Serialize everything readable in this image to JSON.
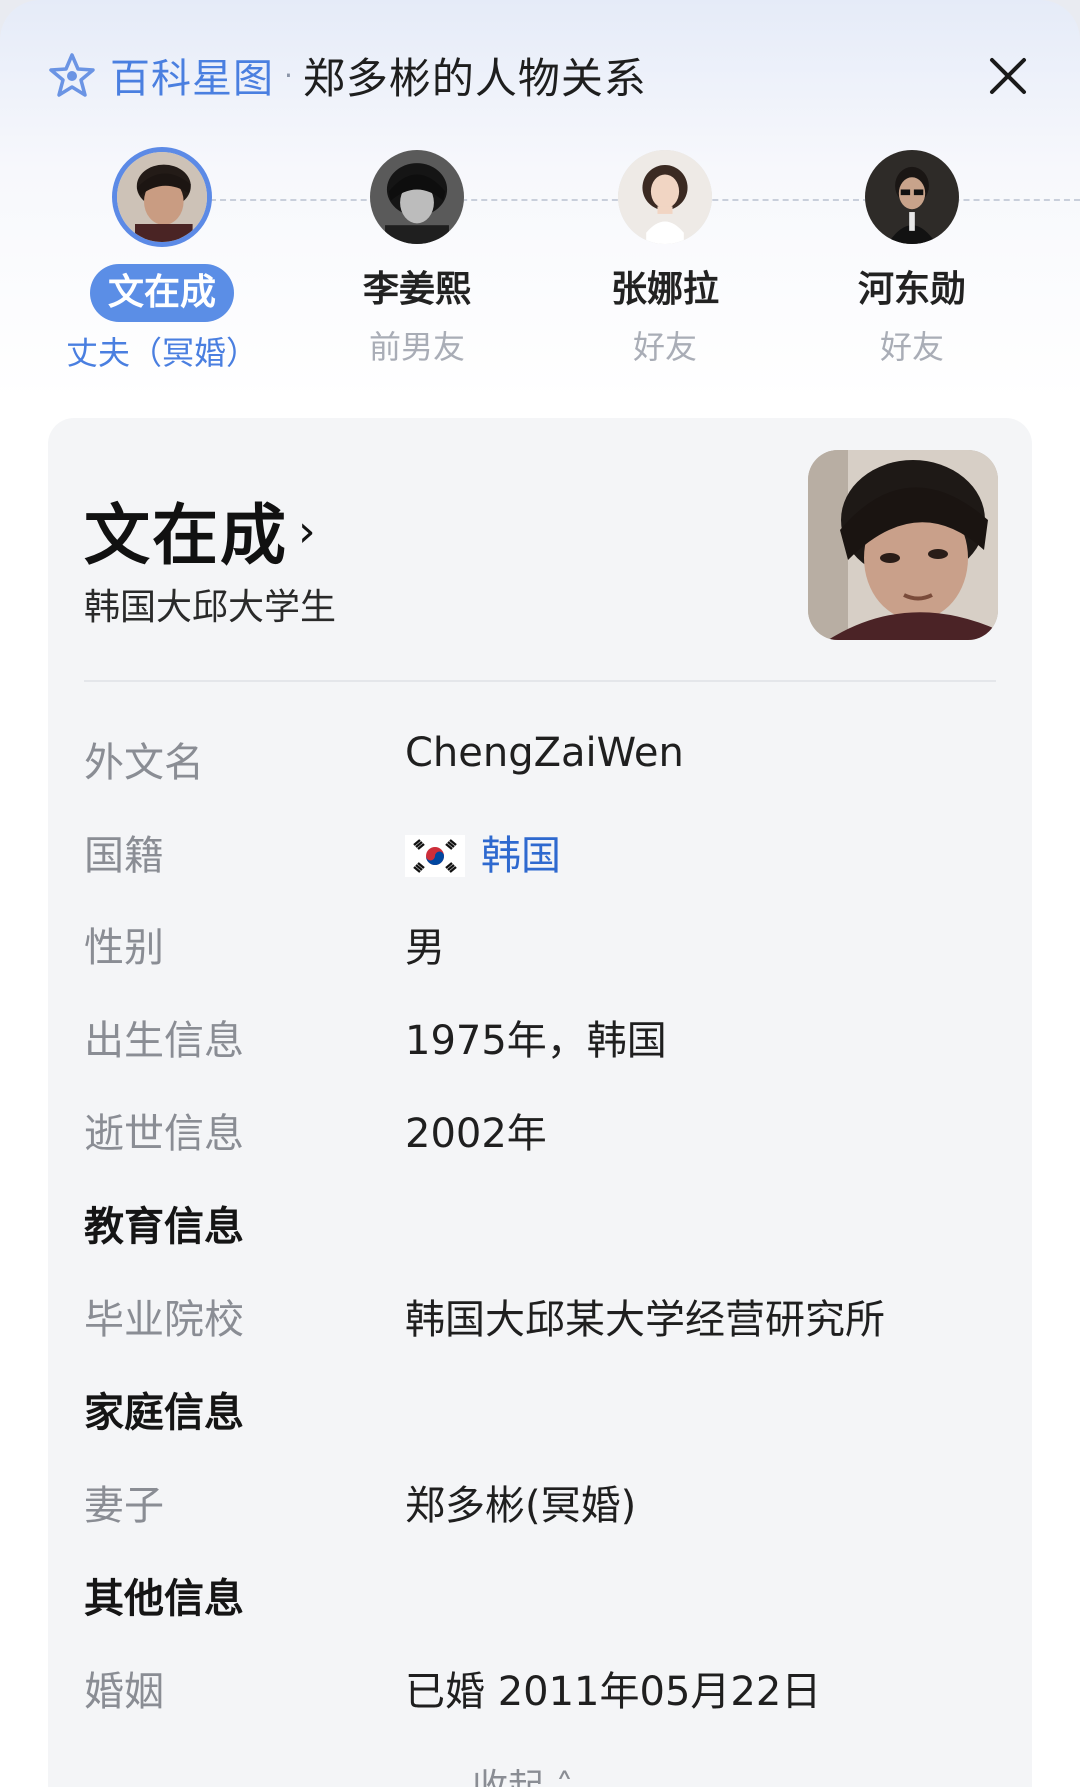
{
  "header": {
    "brand": "百科星图",
    "separator": "·",
    "title": "郑多彬的人物关系",
    "logo_icon": "star-logo-icon",
    "close_icon": "close-icon"
  },
  "relations": [
    {
      "name": "文在成",
      "relation": "丈夫（冥婚）",
      "active": true
    },
    {
      "name": "李姜熙",
      "relation": "前男友",
      "active": false
    },
    {
      "name": "张娜拉",
      "relation": "好友",
      "active": false
    },
    {
      "name": "河东勋",
      "relation": "好友",
      "active": false
    }
  ],
  "card": {
    "name": "文在成",
    "chevron": "›",
    "description": "韩国大邱大学生",
    "rows": {
      "foreign_name": {
        "label": "外文名",
        "value": "ChengZaiWen"
      },
      "nationality": {
        "label": "国籍",
        "value": "韩国",
        "flag_icon": "south-korea-flag-icon"
      },
      "gender": {
        "label": "性别",
        "value": "男"
      },
      "birth": {
        "label": "出生信息",
        "value": "1975年，韩国"
      },
      "death": {
        "label": "逝世信息",
        "value": "2002年"
      }
    },
    "sections": {
      "education": {
        "title": "教育信息",
        "school": {
          "label": "毕业院校",
          "value": "韩国大邱某大学经营研究所"
        }
      },
      "family": {
        "title": "家庭信息",
        "spouse": {
          "label": "妻子",
          "value": "郑多彬(冥婚)"
        }
      },
      "other": {
        "title": "其他信息",
        "marriage": {
          "label": "婚姻",
          "value": "已婚 2011年05月22日"
        }
      }
    },
    "collapse_label": "收起"
  },
  "colors": {
    "accent": "#4a7fe0",
    "active_pill": "#5b8ee6",
    "card_bg": "#f4f5f7",
    "link": "#2e69cf"
  }
}
